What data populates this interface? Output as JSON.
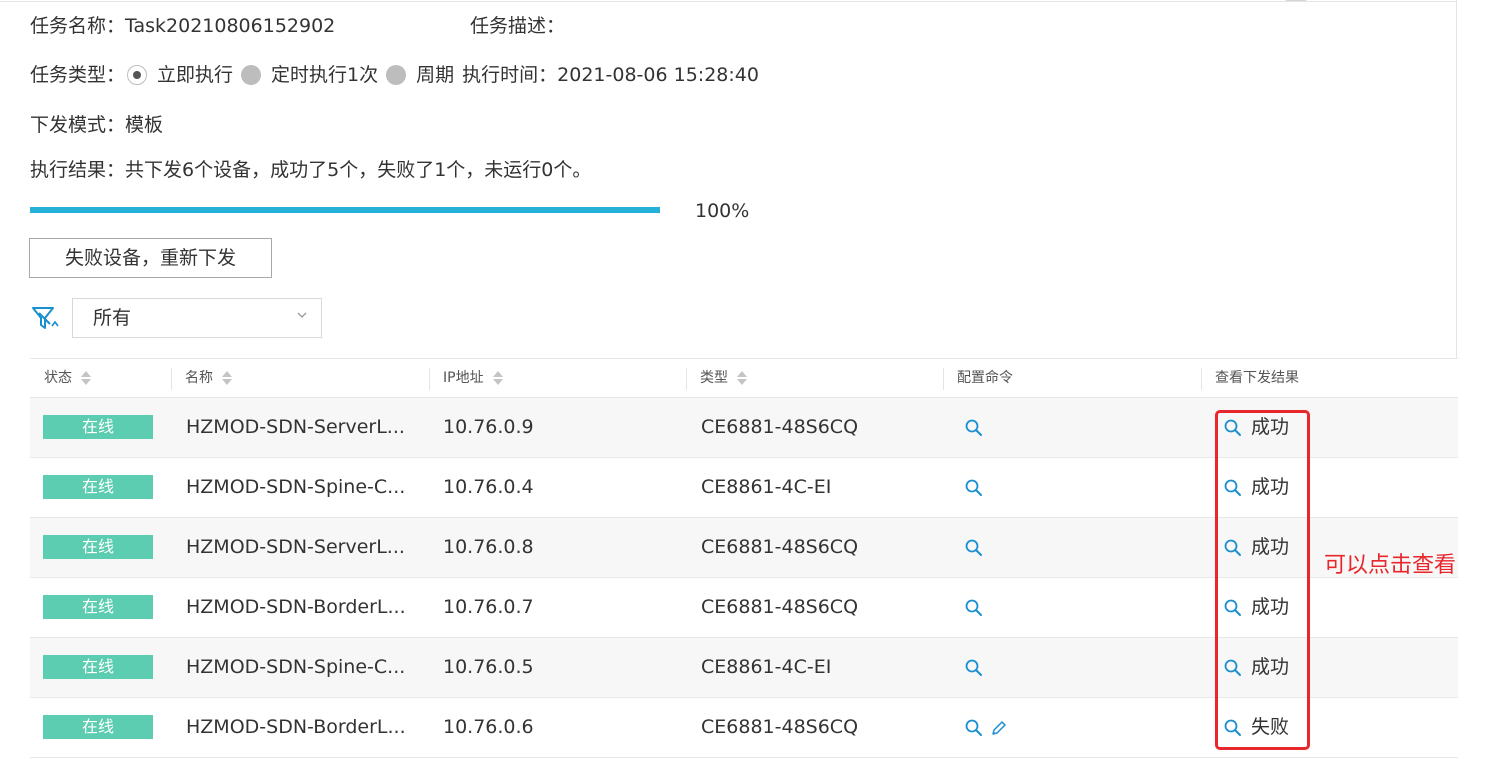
{
  "task": {
    "name_label": "任务名称：",
    "name_value": "Task20210806152902",
    "desc_label": "任务描述：",
    "type_label": "任务类型：",
    "type_options": [
      "立即执行",
      "定时执行1次",
      "周期"
    ],
    "exec_time_label": "执行时间：",
    "exec_time_value": "2021-08-06 15:28:40",
    "mode_label": "下发模式：",
    "mode_value": "模板",
    "result_label": "执行结果：",
    "result_value": "共下发6个设备，成功了5个，失败了1个，未运行0个。"
  },
  "progress": {
    "fraction": 1.0,
    "text": "100%"
  },
  "resend_button": "失败设备，重新下发",
  "filter": {
    "selected": "所有"
  },
  "table": {
    "headers": [
      "状态",
      "名称",
      "IP地址",
      "类型",
      "配置命令",
      "查看下发结果"
    ],
    "rows": [
      {
        "status": "在线",
        "name": "HZMOD-SDN-ServerL...",
        "ip": "10.76.0.9",
        "type": "CE6881-48S6CQ",
        "result": "成功",
        "editable": false
      },
      {
        "status": "在线",
        "name": "HZMOD-SDN-Spine-C...",
        "ip": "10.76.0.4",
        "type": "CE8861-4C-EI",
        "result": "成功",
        "editable": false
      },
      {
        "status": "在线",
        "name": "HZMOD-SDN-ServerL...",
        "ip": "10.76.0.8",
        "type": "CE6881-48S6CQ",
        "result": "成功",
        "editable": false
      },
      {
        "status": "在线",
        "name": "HZMOD-SDN-BorderL...",
        "ip": "10.76.0.7",
        "type": "CE6881-48S6CQ",
        "result": "成功",
        "editable": false
      },
      {
        "status": "在线",
        "name": "HZMOD-SDN-Spine-C...",
        "ip": "10.76.0.5",
        "type": "CE8861-4C-EI",
        "result": "成功",
        "editable": false
      },
      {
        "status": "在线",
        "name": "HZMOD-SDN-BorderL...",
        "ip": "10.76.0.6",
        "type": "CE6881-48S6CQ",
        "result": "失败",
        "editable": true
      }
    ]
  },
  "annotation": "可以点击查看",
  "colors": {
    "progress": "#25b0d8",
    "status_badge": "#5ccdb0",
    "icon": "#1a8fcf",
    "annotation": "#e8262b"
  },
  "icons": {
    "filter": "filter-icon",
    "view_config": "magnifier-icon",
    "edit_config": "pencil-icon",
    "dropdown": "chevron-down-icon"
  }
}
